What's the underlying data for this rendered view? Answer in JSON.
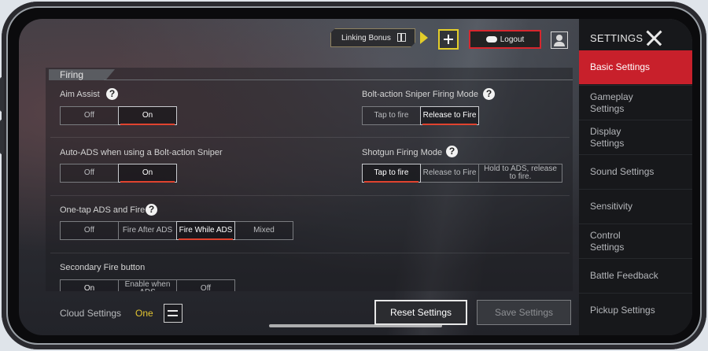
{
  "topbar": {
    "linking_bonus": "Linking Bonus",
    "logout": "Logout"
  },
  "section": {
    "title": "Firing"
  },
  "settings": {
    "aim_assist": {
      "label": "Aim Assist",
      "options": [
        "Off",
        "On"
      ],
      "selected": "On"
    },
    "bolt_sniper_mode": {
      "label": "Bolt-action Sniper Firing Mode",
      "options": [
        "Tap to fire",
        "Release to Fire"
      ],
      "selected": "Release to Fire"
    },
    "auto_ads": {
      "label": "Auto-ADS when using a Bolt-action Sniper",
      "options": [
        "Off",
        "On"
      ],
      "selected": "On"
    },
    "shotgun_mode": {
      "label": "Shotgun Firing Mode",
      "options": [
        "Tap to fire",
        "Release to Fire",
        "Hold to ADS, release to fire."
      ],
      "selected": "Tap to fire"
    },
    "one_tap_ads": {
      "label": "One-tap ADS and Fire",
      "options": [
        "Off",
        "Fire After ADS",
        "Fire While ADS",
        "Mixed"
      ],
      "selected": "Fire While ADS"
    },
    "secondary_fire": {
      "label": "Secondary Fire button",
      "options": [
        "On",
        "Enable when ADS",
        "Off"
      ]
    }
  },
  "help_icon_text": "?",
  "cloud": {
    "label": "Cloud Settings",
    "value": "One"
  },
  "buttons": {
    "reset": "Reset Settings",
    "save": "Save Settings"
  },
  "sidebar": {
    "title": "SETTINGS",
    "items": [
      {
        "label": "Basic Settings",
        "active": true
      },
      {
        "label": "Gameplay Settings"
      },
      {
        "label": "Display Settings"
      },
      {
        "label": "Sound Settings"
      },
      {
        "label": "Sensitivity"
      },
      {
        "label": "Control Settings"
      },
      {
        "label": "Battle Feedback"
      },
      {
        "label": "Pickup Settings"
      }
    ]
  },
  "colors": {
    "accent_red": "#c8202b",
    "accent_yellow": "#e3cd2a",
    "cloud_value": "#e2c431"
  }
}
